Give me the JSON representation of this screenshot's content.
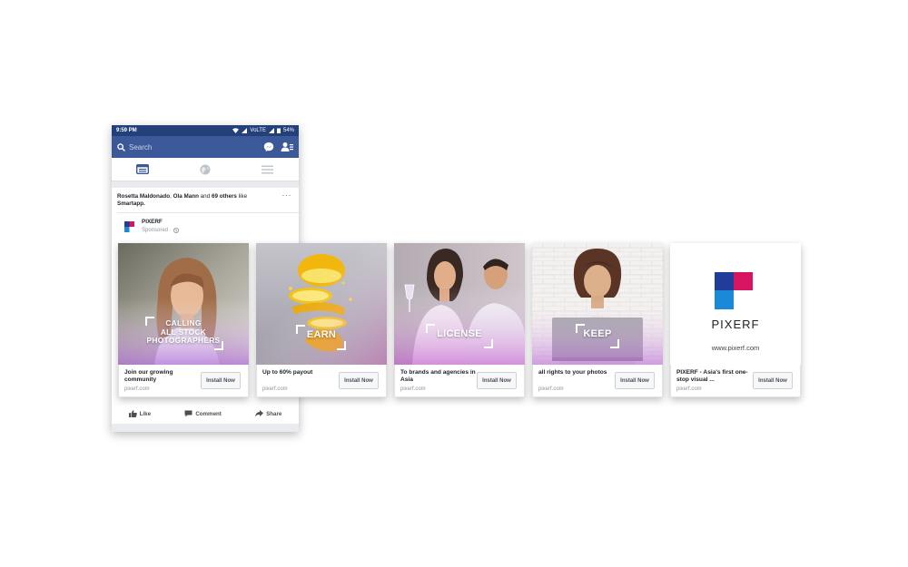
{
  "status_bar": {
    "time": "9:59 PM",
    "network": "VoLTE",
    "battery": "54%"
  },
  "top_bar": {
    "search_placeholder": "Search",
    "icons": [
      "search-icon",
      "messenger-icon",
      "friend-requests-icon"
    ]
  },
  "tabs": [
    {
      "name": "news-feed",
      "icon": "news-feed-icon",
      "active": true
    },
    {
      "name": "notifications",
      "icon": "globe-icon",
      "active": false
    },
    {
      "name": "menu",
      "icon": "menu-icon",
      "active": false
    }
  ],
  "post": {
    "social_name1": "Rosetta Maldonado",
    "social_sep": ", ",
    "social_name2": "Ola Mann",
    "social_and": " and ",
    "social_others": "69 others",
    "social_like": " like",
    "social_page": "Smartapp.",
    "more": "···",
    "page_name": "PIXERF",
    "sponsored": "Sponsored ·"
  },
  "actions": {
    "like": "Like",
    "comment": "Comment",
    "share": "Share"
  },
  "cards": [
    {
      "overlay": [
        "CALLING",
        "ALL STOCK",
        "PHOTOGRAPHERS"
      ],
      "title": "Join our growing community",
      "domain": "pixerf.com",
      "cta": "Install Now"
    },
    {
      "overlay": [
        "EARN"
      ],
      "title": "Up to 60% payout",
      "domain": "pixerf.com",
      "cta": "Install Now"
    },
    {
      "overlay": [
        "LICENSE"
      ],
      "title": "To brands and agencies in Asia",
      "domain": "pixerf.com",
      "cta": "Install Now"
    },
    {
      "overlay": [
        "KEEP"
      ],
      "title": "all rights to your photos",
      "domain": "pixerf.com",
      "cta": "Install Now"
    },
    {
      "brand_name": "PIXERF",
      "brand_url": "www.pixerf.com",
      "title": "PIXERF - Asia's first one-stop visual ...",
      "domain": "pixerf.com",
      "cta": "Install Now"
    }
  ],
  "colors": {
    "facebook_blue": "#3b5998",
    "status_blue": "#23407a",
    "logo_navy": "#1f3d99",
    "logo_pink": "#d6145f",
    "logo_light_blue": "#1a8ad8"
  }
}
